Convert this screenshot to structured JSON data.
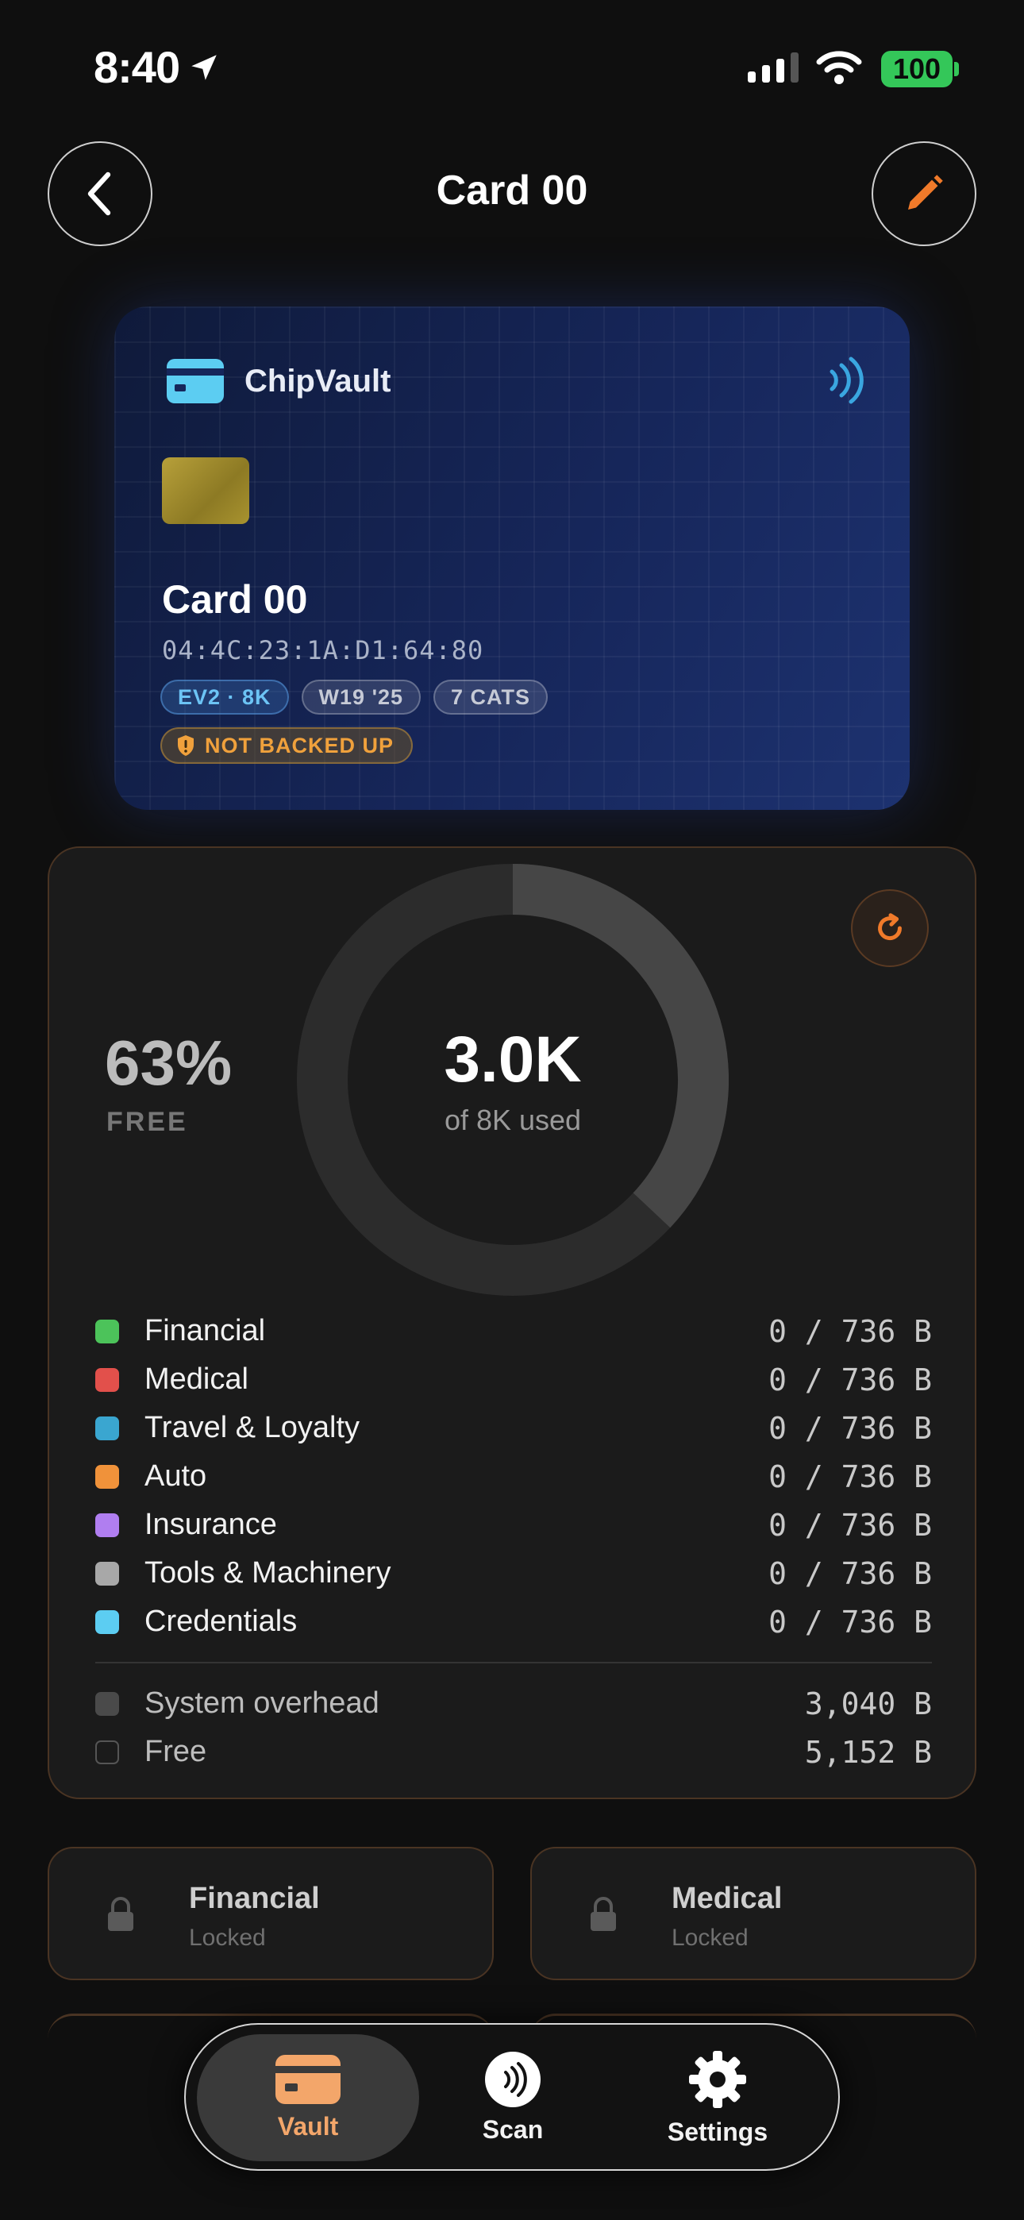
{
  "status_bar": {
    "time": "8:40",
    "battery": "100"
  },
  "nav": {
    "title": "Card 00"
  },
  "card": {
    "brand": "ChipVault",
    "name": "Card 00",
    "uid": "04:4C:23:1A:D1:64:80",
    "tags": [
      "EV2 · 8K",
      "W19 '25",
      "7 CATS"
    ],
    "warning": "NOT BACKED UP"
  },
  "storage": {
    "free_percent": "63%",
    "free_label": "FREE",
    "used_value": "3.0K",
    "used_caption": "of 8K used",
    "used_fraction": 0.37,
    "categories": [
      {
        "name": "Financial",
        "value": "0 / 736 B",
        "color": "#4cc35a"
      },
      {
        "name": "Medical",
        "value": "0 / 736 B",
        "color": "#e2504b"
      },
      {
        "name": "Travel & Loyalty",
        "value": "0 / 736 B",
        "color": "#3aa6d0"
      },
      {
        "name": "Auto",
        "value": "0 / 736 B",
        "color": "#f0923a"
      },
      {
        "name": "Insurance",
        "value": "0 / 736 B",
        "color": "#b07ef0"
      },
      {
        "name": "Tools & Machinery",
        "value": "0 / 736 B",
        "color": "#a8a8a8"
      },
      {
        "name": "Credentials",
        "value": "0 / 736 B",
        "color": "#5ccdf2"
      }
    ],
    "system_overhead": {
      "name": "System overhead",
      "value": "3,040 B",
      "color": "#4a4a4a"
    },
    "free": {
      "name": "Free",
      "value": "5,152 B"
    }
  },
  "category_cards": [
    {
      "name": "Financial",
      "state": "Locked"
    },
    {
      "name": "Medical",
      "state": "Locked"
    }
  ],
  "tab_bar": {
    "tabs": [
      {
        "label": "Vault",
        "icon": "card-icon",
        "active": true
      },
      {
        "label": "Scan",
        "icon": "nfc-icon",
        "active": false
      },
      {
        "label": "Settings",
        "icon": "gear-icon",
        "active": false
      }
    ]
  },
  "colors": {
    "accent": "#f07a2a",
    "background": "#0f0f0f",
    "panel": "#1b1b1b"
  }
}
